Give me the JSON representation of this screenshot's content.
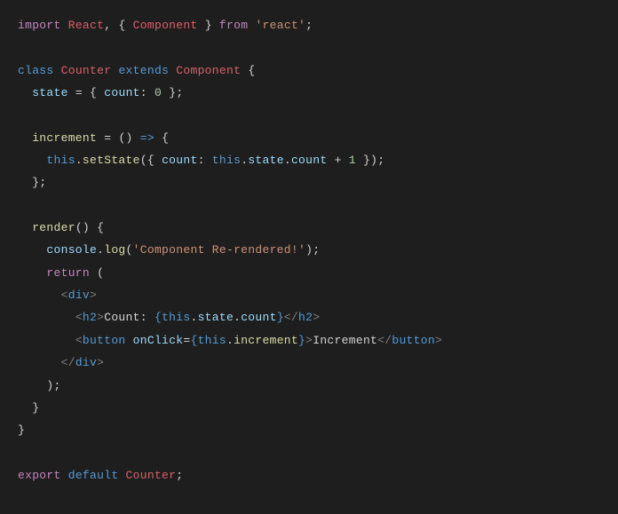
{
  "code": {
    "line1": {
      "import": "import",
      "react": "React",
      "comma": ",",
      "lbrace": "{",
      "component": "Component",
      "rbrace": "}",
      "from": "from",
      "module": "'react'",
      "semi": ";"
    },
    "line3": {
      "class": "class",
      "counter": "Counter",
      "extends": "extends",
      "component": "Component",
      "lbrace": "{"
    },
    "line4": {
      "state": "state",
      "equals": "=",
      "lbrace": "{",
      "count": "count",
      "colon": ":",
      "zero": "0",
      "rbrace": "}",
      "semi": ";"
    },
    "line6": {
      "increment": "increment",
      "equals": "=",
      "parens": "()",
      "arrow": "=>",
      "lbrace": "{"
    },
    "line7": {
      "this": "this",
      "dot1": ".",
      "setstate": "setState",
      "lparen": "(",
      "lbrace": "{",
      "count": "count",
      "colon": ":",
      "this2": "this",
      "dot2": ".",
      "state": "state",
      "dot3": ".",
      "count2": "count",
      "plus": "+",
      "one": "1",
      "rbrace": "}",
      "rparen": ")",
      "semi": ";"
    },
    "line8": {
      "rbrace": "}",
      "semi": ";"
    },
    "line10": {
      "render": "render",
      "parens": "()",
      "lbrace": "{"
    },
    "line11": {
      "console": "console",
      "dot": ".",
      "log": "log",
      "lparen": "(",
      "msg": "'Component Re-rendered!'",
      "rparen": ")",
      "semi": ";"
    },
    "line12": {
      "return": "return",
      "lparen": "("
    },
    "line13": {
      "lt": "<",
      "div": "div",
      "gt": ">"
    },
    "line14": {
      "lt": "<",
      "h2": "h2",
      "gt": ">",
      "text": "Count: ",
      "lbrace": "{",
      "this": "this",
      "dot1": ".",
      "state": "state",
      "dot2": ".",
      "count": "count",
      "rbrace": "}",
      "lt2": "</",
      "h2b": "h2",
      "gt2": ">"
    },
    "line15": {
      "lt": "<",
      "button": "button",
      "onclick": "onClick",
      "equals": "=",
      "lbrace": "{",
      "this": "this",
      "dot": ".",
      "increment": "increment",
      "rbrace": "}",
      "gt": ">",
      "text": "Increment",
      "lt2": "</",
      "button2": "button",
      "gt2": ">"
    },
    "line16": {
      "lt": "</",
      "div": "div",
      "gt": ">"
    },
    "line17": {
      "rparen": ")",
      "semi": ";"
    },
    "line18": {
      "rbrace": "}"
    },
    "line19": {
      "rbrace": "}"
    },
    "line21": {
      "export": "export",
      "default": "default",
      "counter": "Counter",
      "semi": ";"
    }
  }
}
